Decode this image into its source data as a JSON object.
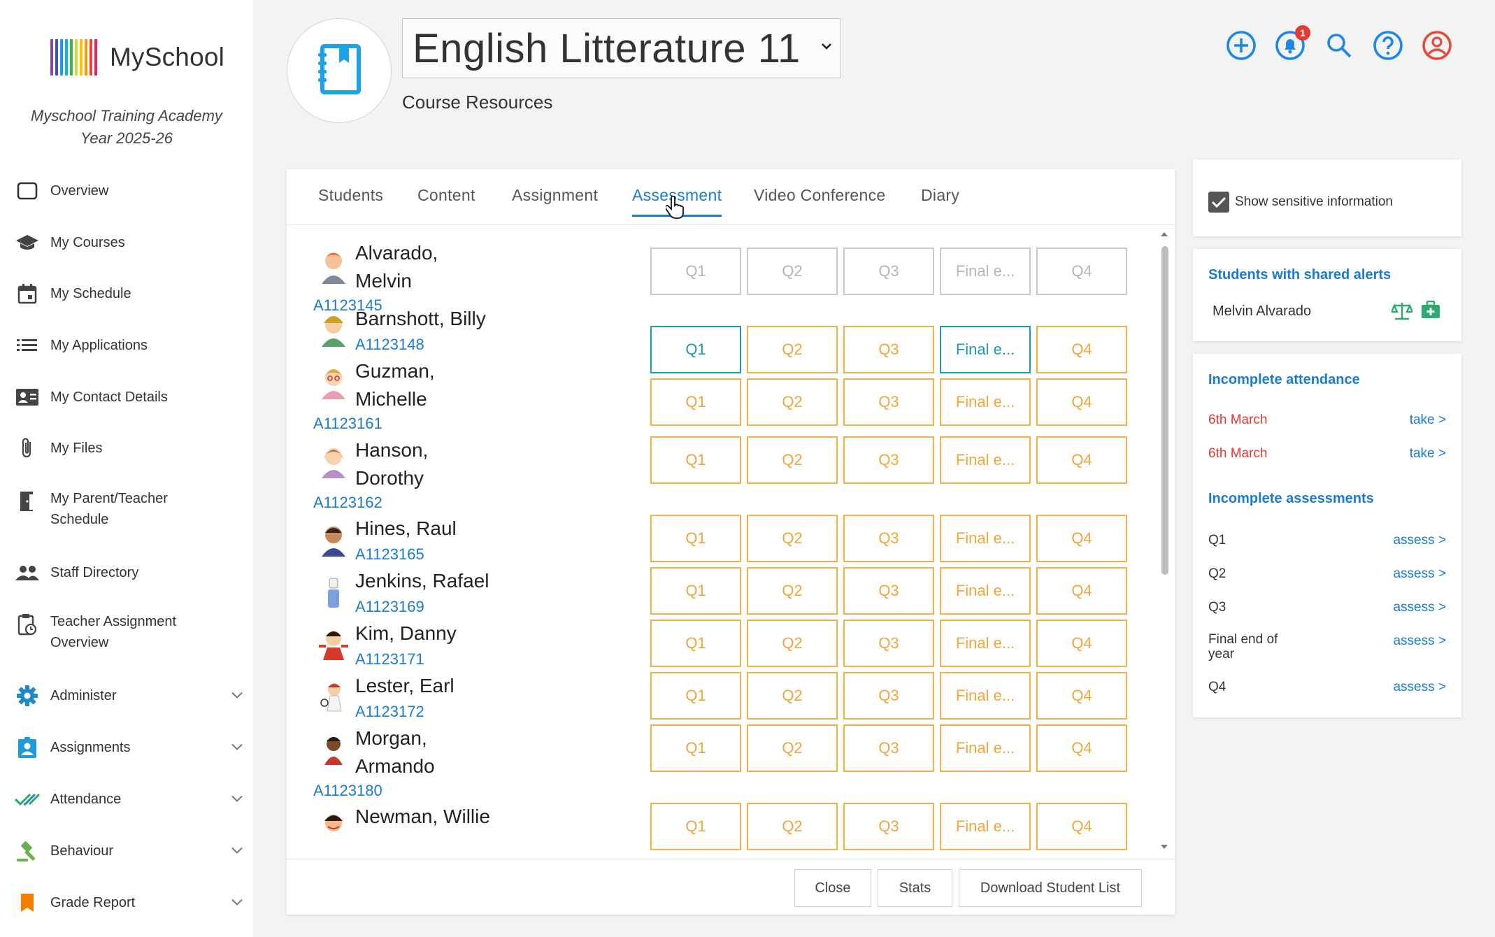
{
  "brand": {
    "name": "MySchool",
    "school": "Myschool Training Academy",
    "year": "Year 2025-26",
    "bar_colors": [
      "#8e44ad",
      "#3f51b5",
      "#2196f3",
      "#00bcd4",
      "#4caf50",
      "#cddc39",
      "#ffc107",
      "#ff9800",
      "#f44336",
      "#e91e63"
    ]
  },
  "sidebar": {
    "items": [
      {
        "label": "Overview",
        "icon": "tablet-icon"
      },
      {
        "label": "My Courses",
        "icon": "graduation-cap-icon"
      },
      {
        "label": "My Schedule",
        "icon": "calendar-icon"
      },
      {
        "label": "My Applications",
        "icon": "list-icon"
      },
      {
        "label": "My Contact Details",
        "icon": "contact-card-icon"
      },
      {
        "label": "My Files",
        "icon": "paperclip-icon"
      },
      {
        "label": "My Parent/Teacher Schedule",
        "icon": "door-icon"
      },
      {
        "label": "Staff Directory",
        "icon": "people-icon"
      },
      {
        "label": "Teacher Assignment Overview",
        "icon": "clipboard-clock-icon"
      },
      {
        "label": "Administer",
        "icon": "gear-icon"
      },
      {
        "label": "Assignments",
        "icon": "assignment-ind-icon"
      },
      {
        "label": "Attendance",
        "icon": "double-check-icon"
      },
      {
        "label": "Behaviour",
        "icon": "gavel-icon"
      },
      {
        "label": "Grade Report",
        "icon": "bookmark-icon"
      }
    ]
  },
  "header": {
    "course_title": "English Litterature 11",
    "course_subtitle": "Course Resources",
    "notification_count": "1"
  },
  "tabs": [
    "Students",
    "Content",
    "Assignment",
    "Assessment",
    "Video Conference",
    "Diary"
  ],
  "active_tab": "Assessment",
  "grade_labels": [
    "Q1",
    "Q2",
    "Q3",
    "Final e...",
    "Q4"
  ],
  "students": [
    {
      "name_line1": "Alvarado,",
      "name_line2": "Melvin",
      "id": "A1123145"
    },
    {
      "name_line1": "Barnshott, Billy",
      "name_line2": "",
      "id": "A1123148"
    },
    {
      "name_line1": "Guzman,",
      "name_line2": "Michelle",
      "id": "A1123161"
    },
    {
      "name_line1": "Hanson,",
      "name_line2": "Dorothy",
      "id": "A1123162"
    },
    {
      "name_line1": "Hines, Raul",
      "name_line2": "",
      "id": "A1123165"
    },
    {
      "name_line1": "Jenkins, Rafael",
      "name_line2": "",
      "id": "A1123169"
    },
    {
      "name_line1": "Kim, Danny",
      "name_line2": "",
      "id": "A1123171"
    },
    {
      "name_line1": "Lester, Earl",
      "name_line2": "",
      "id": "A1123172"
    },
    {
      "name_line1": "Morgan,",
      "name_line2": "Armando",
      "id": "A1123180"
    },
    {
      "name_line1": "Newman, Willie",
      "name_line2": "",
      "id": ""
    }
  ],
  "footer": {
    "close": "Close",
    "stats": "Stats",
    "download": "Download Student List"
  },
  "right": {
    "show_sensitive": "Show sensitive information",
    "shared_alerts_title": "Students with shared alerts",
    "shared_alert_student": "Melvin Alvarado",
    "incomplete_attendance_title": "Incomplete attendance",
    "attendance": [
      {
        "date": "6th March",
        "action": "take >"
      },
      {
        "date": "6th March",
        "action": "take >"
      }
    ],
    "incomplete_assessments_title": "Incomplete assessments",
    "assessments": [
      {
        "label": "Q1",
        "action": "assess >"
      },
      {
        "label": "Q2",
        "action": "assess >"
      },
      {
        "label": "Q3",
        "action": "assess >"
      },
      {
        "label": "Final end of year",
        "action": "assess >"
      },
      {
        "label": "Q4",
        "action": "assess >"
      }
    ]
  },
  "colors": {
    "accent": "#1a7bd0",
    "orange": "#f0b24a",
    "teal": "#1a9bb0",
    "red": "#e53935",
    "green": "#2eaa6e"
  }
}
